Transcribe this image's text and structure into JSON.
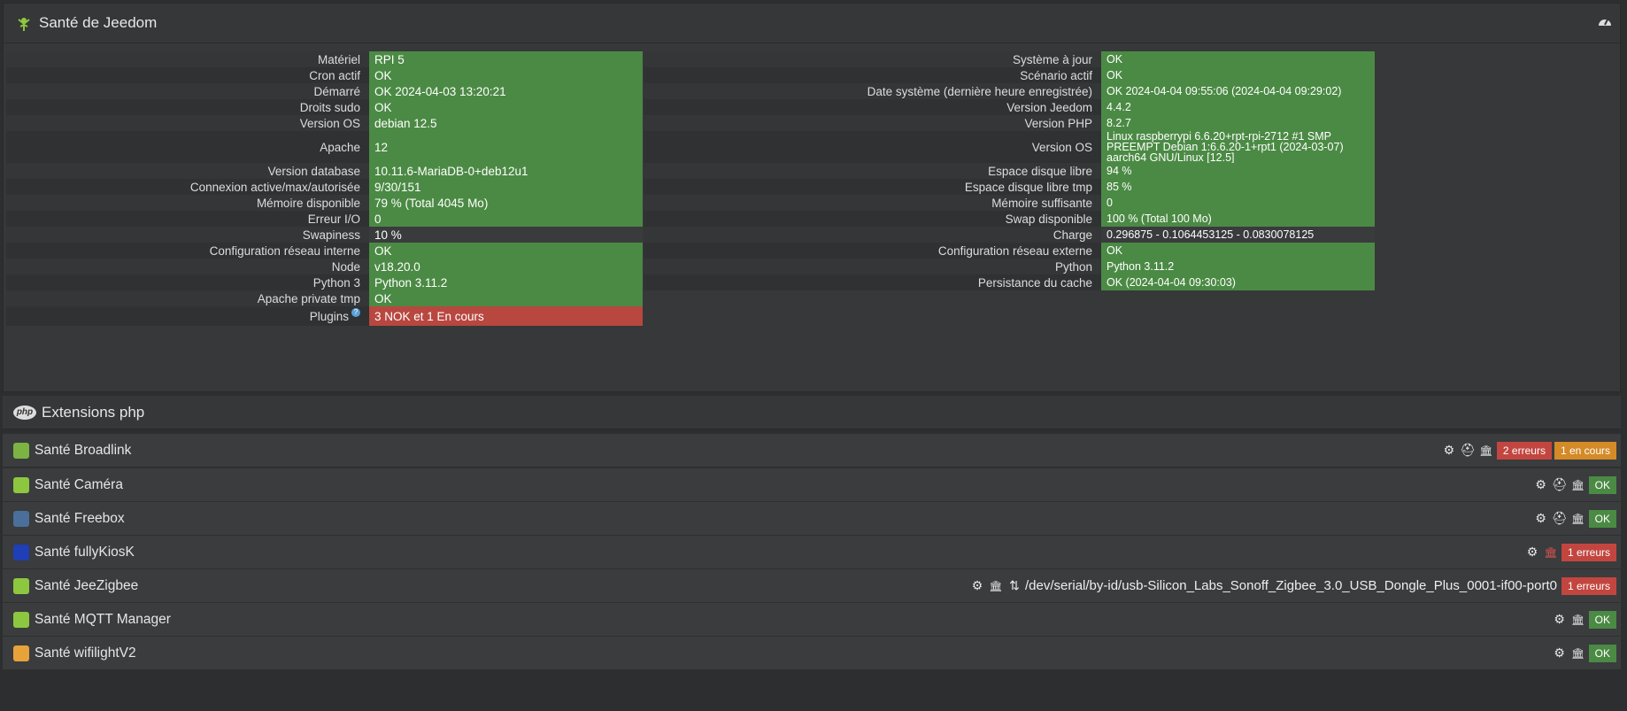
{
  "health": {
    "title": "Santé de Jeedom",
    "left": [
      {
        "label": "Matériel",
        "value": "RPI 5",
        "status": "ok"
      },
      {
        "label": "Cron actif",
        "value": "OK",
        "status": "ok"
      },
      {
        "label": "Démarré",
        "value": "OK 2024-04-03 13:20:21",
        "status": "ok"
      },
      {
        "label": "Droits sudo",
        "value": "OK",
        "status": "ok"
      },
      {
        "label": "Version OS",
        "value": "debian 12.5",
        "status": "ok"
      },
      {
        "label": "Apache",
        "value": "12",
        "status": "ok"
      },
      {
        "label": "Version database",
        "value": "10.11.6-MariaDB-0+deb12u1",
        "status": "ok"
      },
      {
        "label": "Connexion active/max/autorisée",
        "value": "9/30/151",
        "status": "ok"
      },
      {
        "label": "Mémoire disponible",
        "value": "79 % (Total 4045 Mo)",
        "status": "ok"
      },
      {
        "label": "Erreur I/O",
        "value": "0",
        "status": "ok"
      },
      {
        "label": "Swapiness",
        "value": "10 %",
        "status": "neutral"
      },
      {
        "label": "Configuration réseau interne",
        "value": "OK",
        "status": "ok"
      },
      {
        "label": "Node",
        "value": "v18.20.0",
        "status": "ok"
      },
      {
        "label": "Python 3",
        "value": "Python 3.11.2",
        "status": "ok"
      },
      {
        "label": "Apache private tmp",
        "value": "OK",
        "status": "ok"
      },
      {
        "label": "Plugins",
        "value": "3 NOK et 1 En cours",
        "status": "error"
      }
    ],
    "right": [
      {
        "label": "Système à jour",
        "value": "OK",
        "status": "ok"
      },
      {
        "label": "Scénario actif",
        "value": "OK",
        "status": "ok"
      },
      {
        "label": "Date système (dernière heure enregistrée)",
        "value": "OK 2024-04-04 09:55:06 (2024-04-04 09:29:02)",
        "status": "ok"
      },
      {
        "label": "Version Jeedom",
        "value": "4.4.2",
        "status": "ok"
      },
      {
        "label": "Version PHP",
        "value": "8.2.7",
        "status": "ok"
      },
      {
        "label": "Version OS",
        "value": "Linux raspberrypi 6.6.20+rpt-rpi-2712 #1 SMP PREEMPT Debian 1:6.6.20-1+rpt1 (2024-03-07) aarch64 GNU/Linux [12.5]",
        "status": "ok"
      },
      {
        "label": "Espace disque libre",
        "value": "94 %",
        "status": "ok"
      },
      {
        "label": "Espace disque libre tmp",
        "value": "85 %",
        "status": "ok"
      },
      {
        "label": "Mémoire suffisante",
        "value": "0",
        "status": "ok"
      },
      {
        "label": "Swap disponible",
        "value": "100 % (Total 100 Mo)",
        "status": "ok"
      },
      {
        "label": "Charge",
        "value": "0.296875 - 0.1064453125 - 0.0830078125",
        "status": "neutral"
      },
      {
        "label": "Configuration réseau externe",
        "value": "OK",
        "status": "ok"
      },
      {
        "label": "Python",
        "value": "Python 3.11.2",
        "status": "ok"
      },
      {
        "label": "Persistance du cache",
        "value": "OK (2024-04-04 09:30:03)",
        "status": "ok"
      }
    ]
  },
  "extensions": {
    "title": "Extensions php",
    "php_logo": "php"
  },
  "plugins": [
    {
      "name": "Santé Broadlink",
      "icon": "broadlink-icon",
      "badges": [
        {
          "text": "2 erreurs",
          "kind": "err"
        },
        {
          "text": "1 en cours",
          "kind": "run"
        }
      ]
    },
    {
      "name": "Santé Caméra",
      "icon": "camera-icon",
      "badges": [
        {
          "text": "OK",
          "kind": "ok"
        }
      ]
    },
    {
      "name": "Santé Freebox",
      "icon": "freebox-icon",
      "badges": [
        {
          "text": "OK",
          "kind": "ok"
        }
      ]
    },
    {
      "name": "Santé fullyKiosK",
      "icon": "fullykiosk-icon",
      "badges": [
        {
          "text": "1 erreurs",
          "kind": "err"
        }
      ]
    },
    {
      "name": "Santé JeeZigbee",
      "icon": "zigbee-icon",
      "path": "/dev/serial/by-id/usb-Silicon_Labs_Sonoff_Zigbee_3.0_USB_Dongle_Plus_0001-if00-port0",
      "badges": [
        {
          "text": "1 erreurs",
          "kind": "err"
        }
      ]
    },
    {
      "name": "Santé MQTT Manager",
      "icon": "mqtt-icon",
      "badges": [
        {
          "text": "OK",
          "kind": "ok"
        }
      ]
    },
    {
      "name": "Santé wifilightV2",
      "icon": "wifilight-icon",
      "badges": [
        {
          "text": "OK",
          "kind": "ok"
        }
      ]
    }
  ],
  "colors": {
    "ok": "#4b8a44",
    "error": "#b8473f",
    "running": "#d48a27",
    "panel": "#363839"
  }
}
